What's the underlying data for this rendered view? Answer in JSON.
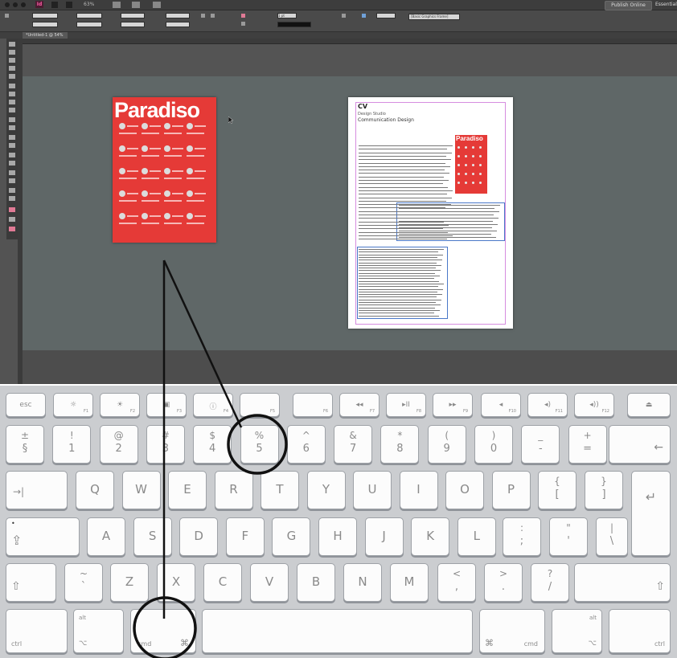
{
  "app": {
    "menubar": {
      "app_id_label": "Id",
      "zoom": "63%",
      "publish_online": "Publish Online",
      "workspace": "Essentials"
    },
    "controlbar": {
      "style_dropdown": "[Basic Graphics Frame]",
      "stroke_weight": "1 pt"
    },
    "document_tab": "*Untitled-1 @ 54%",
    "poster": {
      "title": "Paradiso",
      "accent_color": "#e53a37"
    },
    "cv_page": {
      "title": "CV",
      "subtitle_1": "Design Studio",
      "subtitle_2": "Communication Design",
      "mini_title": "Paradiso"
    }
  },
  "keyboard": {
    "function_row": [
      {
        "label": "esc",
        "sub": ""
      },
      {
        "label": "☼",
        "sub": "F1"
      },
      {
        "label": "☀",
        "sub": "F2"
      },
      {
        "label": "▣",
        "sub": "F3"
      },
      {
        "label": "ⓘ",
        "sub": "F4"
      },
      {
        "label": "",
        "sub": "F5"
      },
      {
        "label": "",
        "sub": "F6"
      },
      {
        "label": "◂◂",
        "sub": "F7"
      },
      {
        "label": "▸II",
        "sub": "F8"
      },
      {
        "label": "▸▸",
        "sub": "F9"
      },
      {
        "label": "◂",
        "sub": "F10"
      },
      {
        "label": "◂)",
        "sub": "F11"
      },
      {
        "label": "◂))",
        "sub": "F12"
      },
      {
        "label": "⏏",
        "sub": ""
      }
    ],
    "number_row": [
      {
        "top": "±",
        "bot": "§"
      },
      {
        "top": "!",
        "bot": "1"
      },
      {
        "top": "@",
        "bot": "2"
      },
      {
        "top": "#",
        "bot": "3"
      },
      {
        "top": "$",
        "bot": "4"
      },
      {
        "top": "%",
        "bot": "5"
      },
      {
        "top": "^",
        "bot": "6"
      },
      {
        "top": "&",
        "bot": "7"
      },
      {
        "top": "*",
        "bot": "8"
      },
      {
        "top": "(",
        "bot": "9"
      },
      {
        "top": ")",
        "bot": "0"
      },
      {
        "top": "_",
        "bot": "-"
      },
      {
        "top": "+",
        "bot": "="
      }
    ],
    "backspace": "←",
    "tab": "→|",
    "qwerty_row": [
      "Q",
      "W",
      "E",
      "R",
      "T",
      "Y",
      "U",
      "I",
      "O",
      "P"
    ],
    "bracket_open": {
      "top": "{",
      "bot": "["
    },
    "bracket_close": {
      "top": "}",
      "bot": "]"
    },
    "return": "↵",
    "caps": "⇪",
    "caps_dot": "•",
    "home_row": [
      "A",
      "S",
      "D",
      "F",
      "G",
      "H",
      "J",
      "K",
      "L"
    ],
    "semicolon": {
      "top": ":",
      "bot": ";"
    },
    "quote": {
      "top": "\"",
      "bot": "'"
    },
    "backslash": {
      "top": "|",
      "bot": "\\"
    },
    "shift_left": "⇧",
    "tilde": {
      "top": "~",
      "bot": "`"
    },
    "bottom_letters": [
      "Z",
      "X",
      "C",
      "V",
      "B",
      "N",
      "M"
    ],
    "comma": {
      "top": "<",
      "bot": ","
    },
    "period": {
      "top": ">",
      "bot": "."
    },
    "slash": {
      "top": "?",
      "bot": "/"
    },
    "shift_right": "⇧",
    "ctrl_left": "ctrl",
    "alt_left_top": "alt",
    "alt_left_bot": "⌥",
    "cmd_left_label": "cmd",
    "cmd_left_symbol": "⌘",
    "cmd_right_label": "cmd",
    "cmd_right_symbol": "⌘",
    "alt_right_top": "alt",
    "alt_right_bot": "⌥",
    "ctrl_right": "ctrl"
  }
}
